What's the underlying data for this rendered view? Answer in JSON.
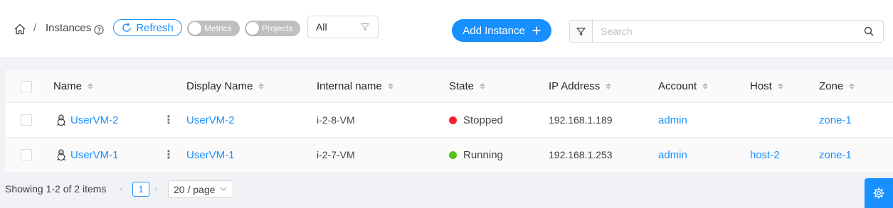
{
  "header": {
    "breadcrumb_current": "Instances",
    "refresh_label": "Refresh",
    "toggle_metrics": "Metrics",
    "toggle_projects": "Projects",
    "filter_value": "All",
    "add_label": "Add Instance",
    "search_placeholder": "Search"
  },
  "table": {
    "columns": [
      "Name",
      "Display Name",
      "Internal name",
      "State",
      "IP Address",
      "Account",
      "Host",
      "Zone"
    ],
    "rows": [
      {
        "name": "UserVM-2",
        "display": "UserVM-2",
        "internal": "i-2-8-VM",
        "state": "Stopped",
        "state_color": "#f5222d",
        "ip": "192.168.1.189",
        "account": "admin",
        "host": "",
        "zone": "zone-1"
      },
      {
        "name": "UserVM-1",
        "display": "UserVM-1",
        "internal": "i-2-7-VM",
        "state": "Running",
        "state_color": "#52c41a",
        "ip": "192.168.1.253",
        "account": "admin",
        "host": "host-2",
        "zone": "zone-1"
      }
    ]
  },
  "pagination": {
    "showing": "Showing 1-2 of 2 items",
    "current_page": "1",
    "page_size": "20 / page"
  },
  "colors": {
    "accent": "#1890ff"
  }
}
